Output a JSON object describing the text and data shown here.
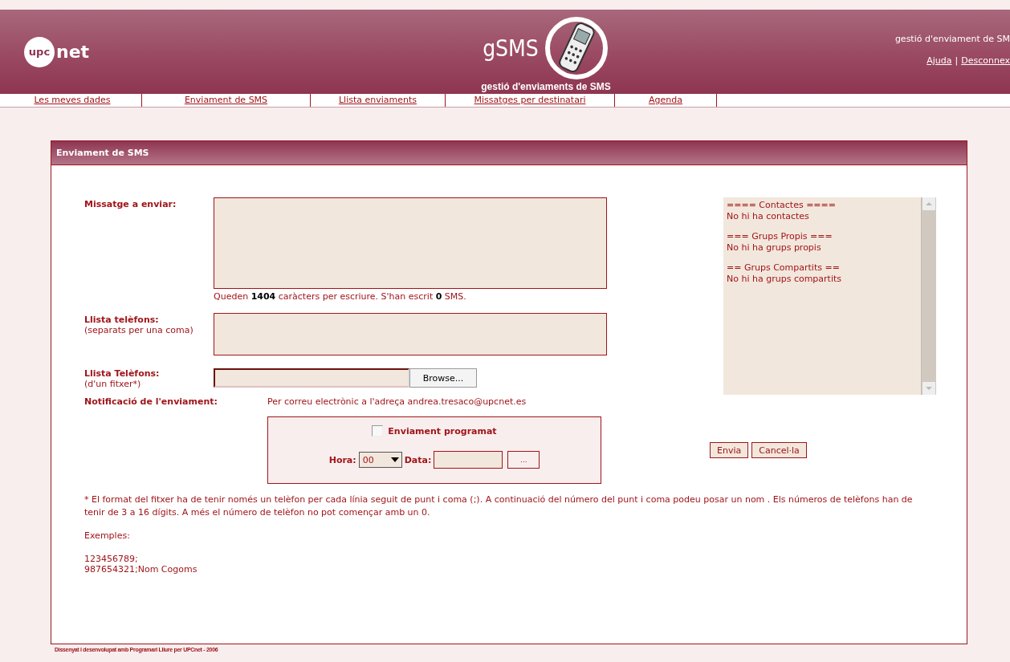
{
  "header": {
    "logo": {
      "badge": "upc",
      "word": "net"
    },
    "app_title": "gSMS",
    "subtitle": "gestió d'enviaments de SMS",
    "tagline": "gestió d'enviament de SM",
    "links": [
      "Ajuda",
      "Desconnex"
    ],
    "link_separator": "|"
  },
  "nav": {
    "items": [
      "Les meves dades",
      "Enviament de SMS",
      "Llista enviaments",
      "Missatges per destinatari",
      "Agenda"
    ]
  },
  "panel": {
    "title": "Enviament de SMS"
  },
  "form": {
    "message": {
      "label": "Missatge a enviar:",
      "counter": "Queden **1404** caràcters per escriure. S'han escrit **0** SMS."
    },
    "phones": {
      "label": "Llista telèfons:",
      "hint": "(separats per una coma)"
    },
    "file": {
      "label": "Llista Telèfons:",
      "hint": "(d'un fitxer*)",
      "button": "Browse..."
    },
    "notification": {
      "label": "Notificació de l'enviament:",
      "value": "Per correu electrònic a l'adreça andrea.tresaco@upcnet.es"
    },
    "schedule": {
      "label": "Enviament programat",
      "checked": false,
      "hour_label": "Hora:",
      "hour": "00",
      "date_label": "Data:",
      "date_button": "..."
    },
    "buttons": [
      "Envia",
      "Cancel·la"
    ]
  },
  "contacts": {
    "groups": [
      {
        "heading": "==== Contactes ====",
        "text": "No hi ha contactes"
      },
      {
        "heading": "=== Grups Propis ===",
        "text": "No hi ha grups propis"
      },
      {
        "heading": "== Grups Compartits ==",
        "text": "No hi ha grups compartits"
      }
    ]
  },
  "notes": {
    "text": "* El format del fitxer ha de tenir només un telèfon per cada línia seguit de punt i coma (;). A continuació del número del punt i coma podeu posar un nom . Els números de telèfons han de tenir de 3 a 16 dígits. A més el número de telèfon no pot començar amb un 0.",
    "examples_label": "Exemples:",
    "examples": [
      "123456789;",
      "987654321;Nom Cogoms"
    ]
  },
  "footer": "Dissenyat i desenvolupat amb Programari Lliure per UPCnet - 2006"
}
